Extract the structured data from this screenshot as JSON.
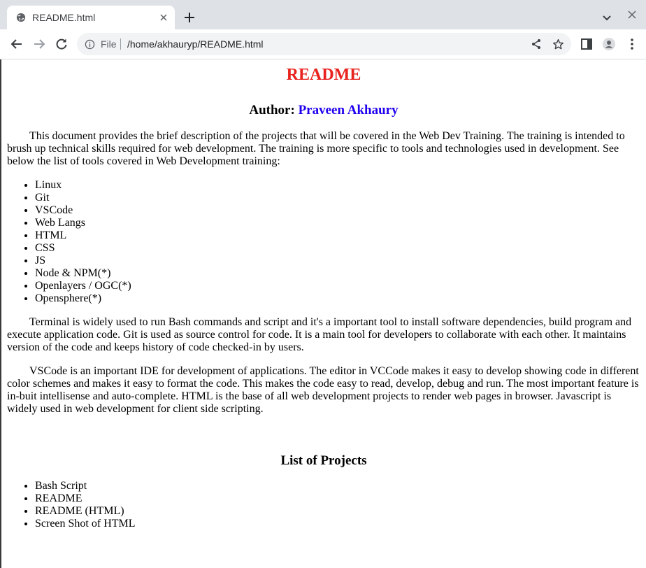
{
  "browser": {
    "tab_title": "README.html",
    "scheme_label": "File",
    "url": "/home/akhauryp/README.html"
  },
  "page": {
    "title": "README",
    "author_label": "Author:",
    "author_name": "Praveen Akhaury",
    "intro": "This document provides the brief description of the projects that will be covered in the Web Dev Training. The training is intended to brush up technical skills required for web development. The training is more specific to tools and technologies used in development. See below the list of tools covered in Web Development training:",
    "tools": [
      "Linux",
      "Git",
      "VSCode",
      "Web Langs",
      "HTML",
      "CSS",
      "JS",
      "Node & NPM(*)",
      "Openlayers / OGC(*)",
      "Opensphere(*)"
    ],
    "paragraph2": "Terminal is widely used to run Bash commands and script and it's a important tool to install software dependencies, build program and execute application code. Git is used as source control for code. It is a main tool for developers to collaborate with each other. It maintains version of the code and keeps history of code checked-in by users.",
    "paragraph3": "VSCode is an important IDE for development of applications. The editor in VCCode makes it easy to develop showing code in different color schemes and makes it easy to format the code. This makes the code easy to read, develop, debug and run. The most important feature is in-buit intellisense and auto-complete. HTML is the base of all web development projects to render web pages in browser. Javascript is widely used in web development for client side scripting.",
    "projects_heading": "List of Projects",
    "projects": [
      "Bash Script",
      "README",
      "README (HTML)",
      "Screen Shot of HTML"
    ]
  },
  "colors": {
    "title": "#e8221d",
    "author_name": "#1f00ee"
  },
  "icons": [
    "globe-icon",
    "close-icon",
    "plus-icon",
    "chevron-down-icon",
    "back-arrow-icon",
    "forward-arrow-icon",
    "reload-icon",
    "info-icon",
    "share-icon",
    "star-icon",
    "side-panel-icon",
    "profile-icon",
    "kebab-menu-icon"
  ]
}
